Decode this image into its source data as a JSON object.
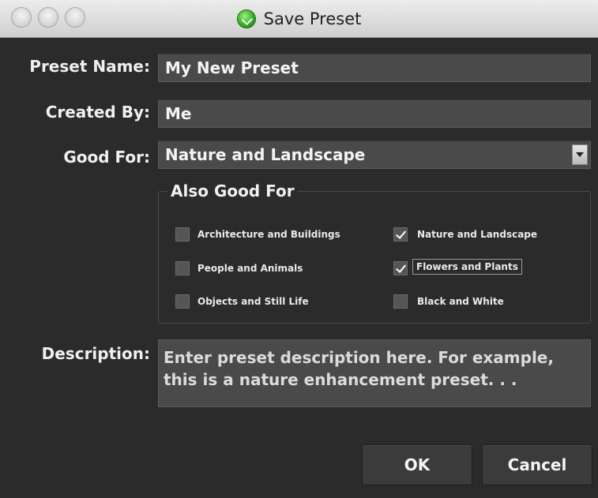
{
  "window": {
    "title": "Save Preset"
  },
  "form": {
    "preset_name_label": "Preset Name:",
    "preset_name_value": "My New Preset",
    "created_by_label": "Created By:",
    "created_by_value": "Me",
    "good_for_label": "Good For:",
    "good_for_value": "Nature and Landscape",
    "description_label": "Description:",
    "description_value": "Enter preset description here. For example, this is a nature enhancement preset. . ."
  },
  "also_good_for": {
    "legend": "Also Good For",
    "options": [
      {
        "label": "Architecture and Buildings",
        "checked": false
      },
      {
        "label": "Nature and Landscape",
        "checked": true
      },
      {
        "label": "People and Animals",
        "checked": false
      },
      {
        "label": "Flowers and Plants",
        "checked": true
      },
      {
        "label": "Objects and Still Life",
        "checked": false
      },
      {
        "label": "Black and White",
        "checked": false
      }
    ]
  },
  "buttons": {
    "ok": "OK",
    "cancel": "Cancel"
  }
}
